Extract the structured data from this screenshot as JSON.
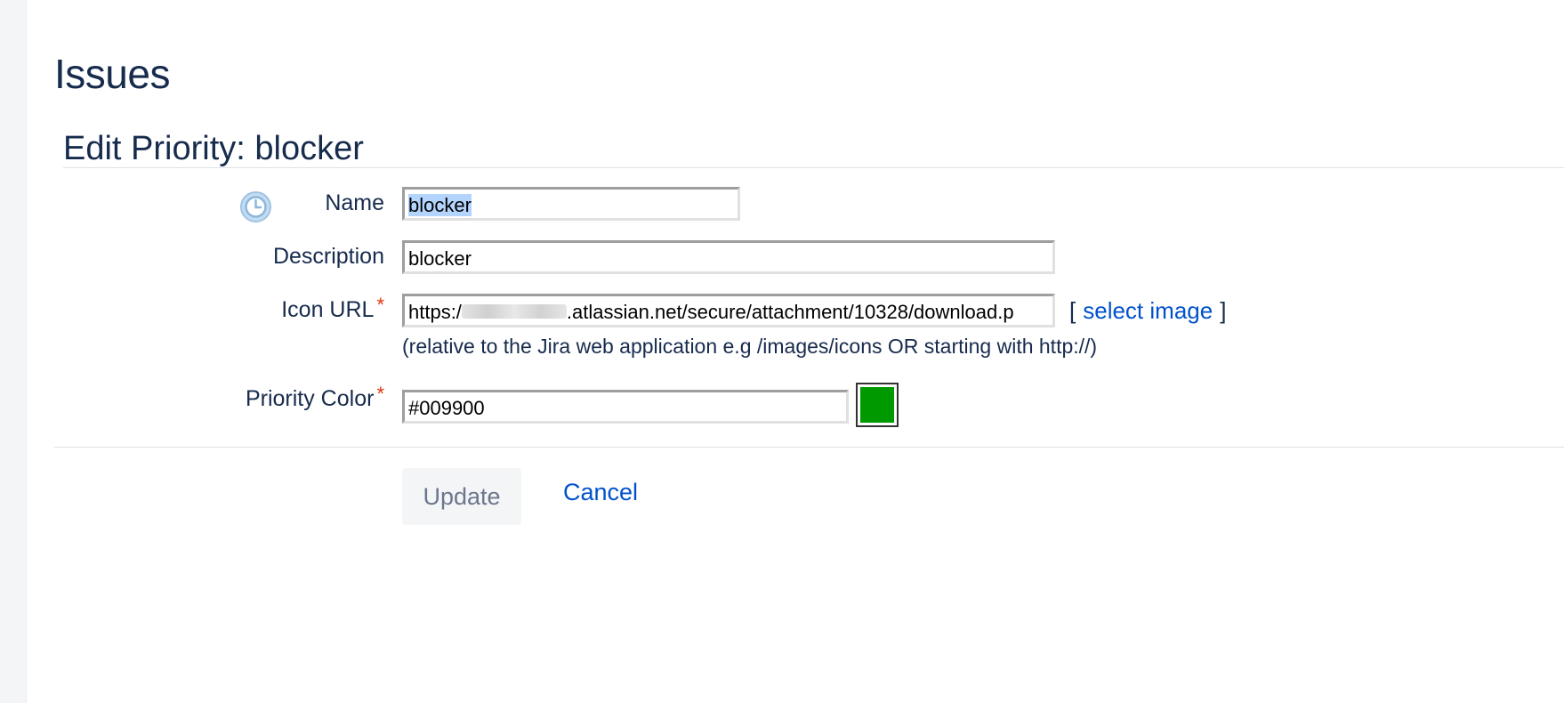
{
  "page": {
    "title": "Issues",
    "section_title": "Edit Priority: blocker"
  },
  "form": {
    "name": {
      "label": "Name",
      "value": "blocker"
    },
    "description": {
      "label": "Description",
      "value": "blocker"
    },
    "icon_url": {
      "label": "Icon URL",
      "required_mark": "*",
      "value_prefix": "https:/",
      "value_suffix": ".atlassian.net/secure/attachment/10328/download.p",
      "select_image_open": "[",
      "select_image_label": "select image",
      "select_image_close": "]",
      "hint": "(relative to the Jira web application e.g /images/icons OR starting with http://)"
    },
    "priority_color": {
      "label": "Priority Color",
      "required_mark": "*",
      "value": "#009900",
      "swatch_color": "#009900"
    }
  },
  "actions": {
    "update_label": "Update",
    "cancel_label": "Cancel"
  },
  "icons": {
    "priority_icon": "clock-icon"
  },
  "colors": {
    "text": "#172b4d",
    "link": "#0052cc",
    "required": "#de350b",
    "selection": "#b3d4fc"
  }
}
